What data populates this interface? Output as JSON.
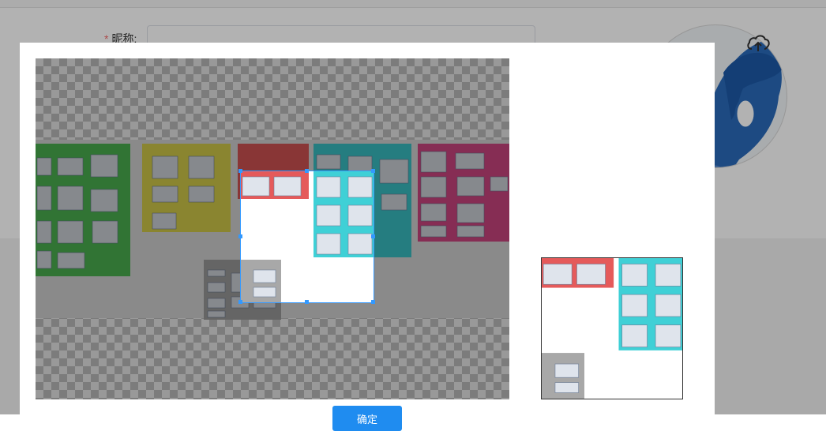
{
  "form": {
    "nickname_label": "昵称:",
    "required_mark": "*",
    "nickname_value": ""
  },
  "avatar": {
    "icon": "user-portrait",
    "upload_icon": "cloud-upload-icon"
  },
  "cropper": {
    "board_colors": {
      "green": "#53c158",
      "yellow": "#e7de50",
      "red": "#e55a5a",
      "cyan": "#3fd0d6",
      "pink": "#e04c8d",
      "gray": "#9f9f9f"
    }
  },
  "dialog": {
    "confirm_label": "确定"
  },
  "colors": {
    "accent": "#1f8cf0",
    "required": "#f56c6c"
  }
}
